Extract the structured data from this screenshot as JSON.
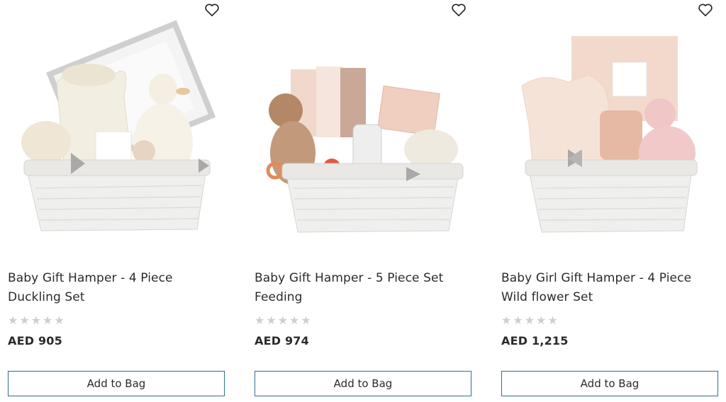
{
  "products": [
    {
      "title_line1": "Baby Gift Hamper - 4 Piece",
      "title_line2": "Duckling Set",
      "rating": 0,
      "price": "AED 905",
      "button_label": "Add to Bag",
      "image_desc_icon": "gift-hamper-image"
    },
    {
      "title_line1": "Baby Gift Hamper - 5 Piece Set",
      "title_line2": "Feeding",
      "rating": 0,
      "price": "AED 974",
      "button_label": "Add to Bag",
      "image_desc_icon": "gift-hamper-image"
    },
    {
      "title_line1": "Baby Girl Gift Hamper - 4 Piece",
      "title_line2": "Wild flower Set",
      "rating": 0,
      "price": "AED 1,215",
      "button_label": "Add to Bag",
      "image_desc_icon": "gift-hamper-image"
    }
  ],
  "colors": {
    "button_border": "#2f6f8f",
    "star_empty": "#cfcfcf",
    "text": "#2b2b2b"
  }
}
